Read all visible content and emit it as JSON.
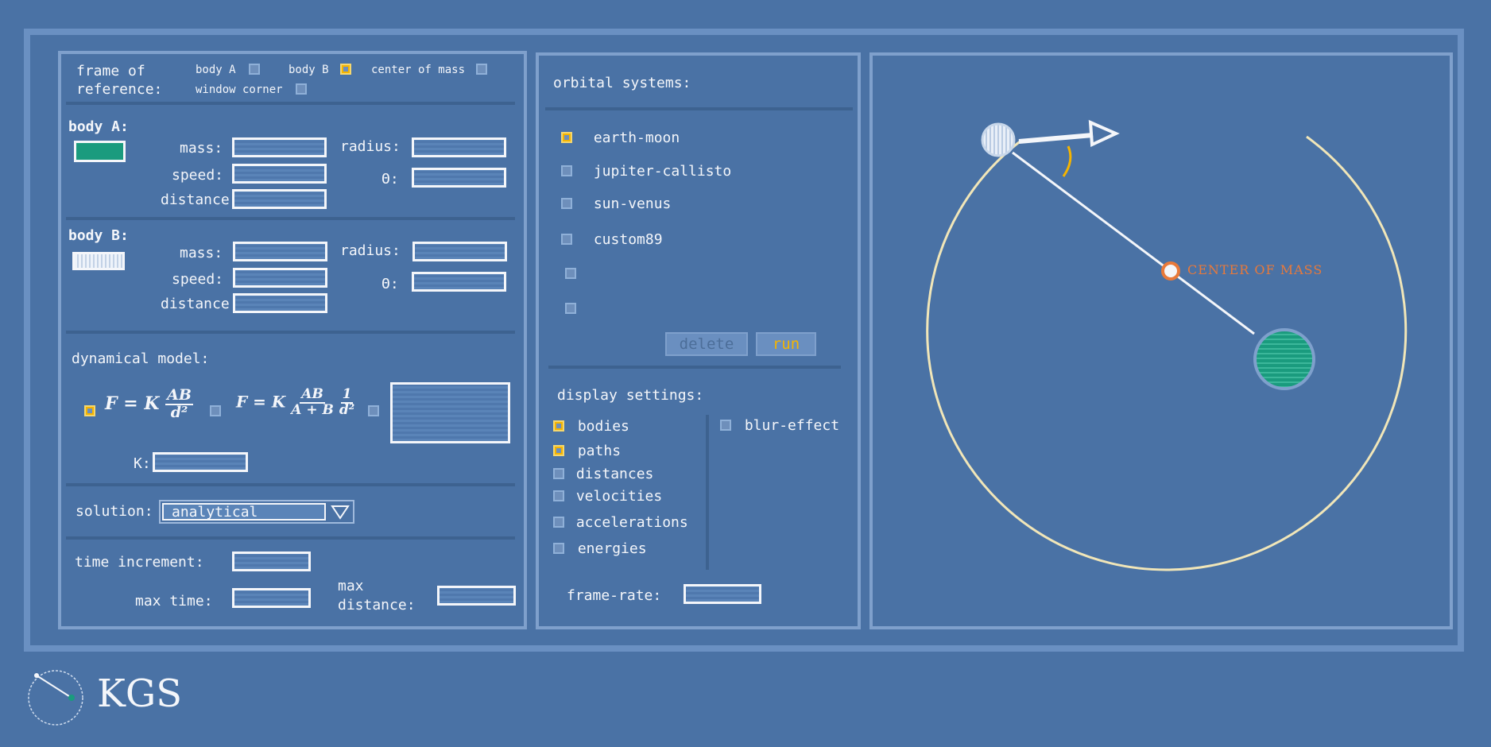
{
  "frame_of_reference": {
    "label_line1": "frame of",
    "label_line2": "reference:",
    "options": [
      {
        "label": "body A",
        "checked": false
      },
      {
        "label": "body B",
        "checked": true
      },
      {
        "label": "center of mass",
        "checked": false
      },
      {
        "label": "window corner",
        "checked": false
      }
    ]
  },
  "body_a": {
    "title": "body A:",
    "mass_label": "mass:",
    "speed_label": "speed:",
    "distance_label": "distance:",
    "radius_label": "radius:",
    "theta_label": "Θ:",
    "swatch_color": "#1a9b7e"
  },
  "body_b": {
    "title": "body B:",
    "mass_label": "mass:",
    "speed_label": "speed:",
    "distance_label": "distance:",
    "radius_label": "radius:",
    "theta_label": "Θ:",
    "swatch_color": "#dfe7f2"
  },
  "dynamical_model": {
    "title": "dynamical model:",
    "formula1": {
      "lhs": "F = K",
      "num": "AB",
      "den": "d²",
      "checked": true
    },
    "formula2": {
      "lhs": "F = K",
      "num": "AB",
      "den": "A + B",
      "num2": "1",
      "den2": "d²",
      "checked": false
    },
    "custom_checked": false,
    "k_label": "K:"
  },
  "solution": {
    "label": "solution:",
    "value": "analytical"
  },
  "time": {
    "increment_label": "time increment:",
    "max_time_label": "max time:",
    "max_distance_line1": "max",
    "max_distance_line2": "distance:"
  },
  "orbital_systems": {
    "title": "orbital systems:",
    "items": [
      {
        "label": "earth-moon",
        "checked": true
      },
      {
        "label": "jupiter-callisto",
        "checked": false
      },
      {
        "label": "sun-venus",
        "checked": false
      },
      {
        "label": "custom89",
        "checked": false
      },
      {
        "label": "",
        "checked": false
      },
      {
        "label": "",
        "checked": false
      }
    ],
    "delete_label": "delete",
    "run_label": "run"
  },
  "display_settings": {
    "title": "display settings:",
    "items": [
      {
        "label": "bodies",
        "checked": true
      },
      {
        "label": "paths",
        "checked": true
      },
      {
        "label": "distances",
        "checked": false
      },
      {
        "label": "velocities",
        "checked": false
      },
      {
        "label": "accelerations",
        "checked": false
      },
      {
        "label": "energies",
        "checked": false
      }
    ],
    "blur_label": "blur-effect",
    "blur_checked": false,
    "frame_rate_label": "frame-rate:"
  },
  "simulation": {
    "center_of_mass_label": "CENTER OF MASS",
    "orbit_color": "#f1e6b8",
    "com_color": "#e8793a",
    "velocity_angle_color": "#f5b400"
  },
  "logo": {
    "text": "KGS"
  },
  "colors": {
    "background": "#4a72a5",
    "panel_border": "#7fa0cc",
    "accent": "#f5b400"
  }
}
